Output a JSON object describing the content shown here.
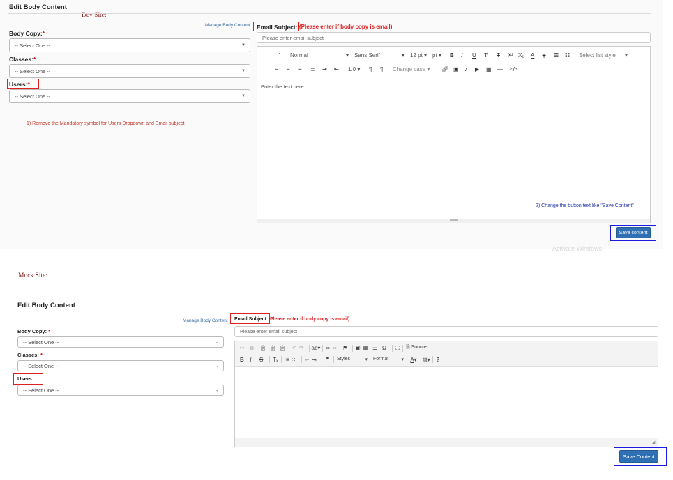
{
  "dev": {
    "site_label": "Dev Site:",
    "title": "Edit Body Content",
    "manage_link": "Manage Body Content",
    "body_copy_label": "Body Copy:",
    "classes_label": "Classes:",
    "users_label": "Users:",
    "req": "*",
    "select_placeholder": "-- Select One --",
    "email_label": "Email Subject:",
    "email_req": "*",
    "email_note": "(Please enter if body copy is email)",
    "email_placeholder": "Please enter email subject",
    "toolbar": {
      "style": "Normal",
      "font": "Sans Serif",
      "size": "12 pt",
      "unit": "pt",
      "list_style": "Select list style",
      "line_height": "1.0",
      "change_case": "Change case"
    },
    "editor_placeholder": "Enter the text here",
    "annotation1": "1) Remove the Mandatory symbol for Users Dropdown and Email subject",
    "annotation2": "2) Change the button text like \"Save Content\"",
    "save_button": "Save content",
    "watermark": "Activate Windows"
  },
  "mock": {
    "site_label": "Mock Site:",
    "title": "Edit Body Content",
    "manage_link": "Manage Body Content",
    "body_copy_label": "Body Copy:",
    "classes_label": "Classes:",
    "users_label": "Users:",
    "req": "*",
    "select_placeholder": "-- Select One --",
    "email_label": "Email Subject:",
    "email_note": "Please enter if body copy is email)",
    "email_placeholder": "Please enter email subject",
    "toolbar": {
      "source": "Source",
      "styles": "Styles",
      "format": "Format"
    },
    "save_button": "Save Content"
  }
}
